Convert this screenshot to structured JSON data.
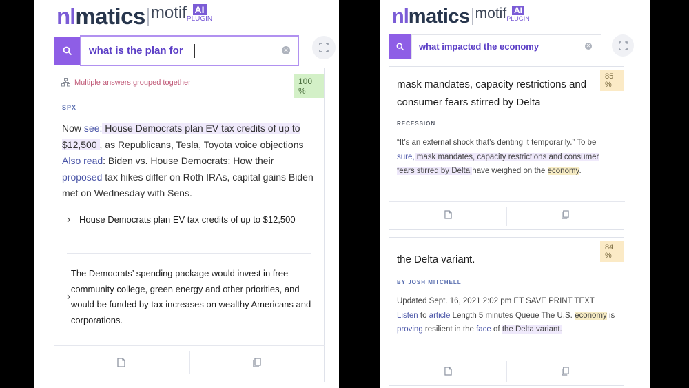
{
  "colors": {
    "accent": "#8e5ee6",
    "brand_nl": "#7b5cd6",
    "brand_matics": "#28364d",
    "highlight_purple": "#efe9fb",
    "highlight_yellow": "#f7ecc4",
    "link": "#4b56a8",
    "badge_green": "#d3f0c7",
    "badge_yellow": "#fbeac6"
  },
  "brand": {
    "nl": "nl",
    "matics": "matics",
    "motif": "motif",
    "ai": "AI",
    "plugin": "PLUGIN"
  },
  "left": {
    "search": {
      "value": "what is the plan for"
    },
    "card": {
      "group_note": "Multiple answers grouped together",
      "score": "100 %",
      "source": "SPX",
      "para": [
        "Now ",
        "see:",
        " House Democrats plan EV tax credits of up to $12,500 ",
        ", as Republicans, Tesla, Toyota voice objections ",
        "Also read",
        ": Biden vs. House Democrats: How their ",
        "proposed",
        " tax hikes differ on Roth IRAs, capital gains Biden met on Wednesday with Sens."
      ],
      "answers": [
        "House Democrats plan EV tax credits of up to $12,500",
        "The Democrats’ spending package would invest in free community college, green energy and other priorities, and would be funded by tax increases on wealthy Americans and corporations."
      ]
    }
  },
  "right": {
    "search": {
      "value": "what impacted the economy"
    },
    "card1": {
      "title": "mask mandates, capacity restrictions and consumer fears stirred by Delta",
      "score": "85 %",
      "source": "RECESSION",
      "para": [
        "“It’s an external shock that’s denting it temporarily.” To be ",
        "sure,",
        " mask mandates, capacity restrictions and consumer fears stirred by Delta ",
        " have weighed on the ",
        "economy",
        "."
      ]
    },
    "card2": {
      "title": "the Delta variant.",
      "score": "84 %",
      "source": "BY JOSH MITCHELL",
      "para": [
        "Updated Sept. 16, 2021 2:02 pm ET SAVE PRINT TEXT ",
        "Listen",
        " to ",
        "article",
        " Length 5 minutes Queue The U.S. ",
        "economy",
        " is ",
        "proving",
        " resilient in the ",
        "face",
        " of ",
        " the Delta variant."
      ]
    }
  },
  "icons": {
    "search": "search-icon",
    "clear": "clear-icon",
    "expand": "expand-icon",
    "group": "group-icon",
    "document": "document-icon",
    "copy": "copy-icon",
    "chevron": "chevron-right-icon"
  }
}
